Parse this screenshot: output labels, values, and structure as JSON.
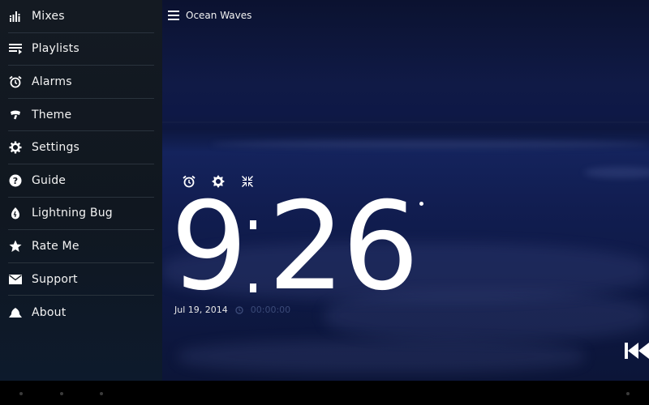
{
  "topbar": {
    "title": "Ocean Waves",
    "menu_icon": "hamburger-icon"
  },
  "drawer": {
    "items": [
      {
        "label": "Mixes",
        "icon": "equalizer-icon"
      },
      {
        "label": "Playlists",
        "icon": "playlist-icon"
      },
      {
        "label": "Alarms",
        "icon": "alarm-icon"
      },
      {
        "label": "Theme",
        "icon": "paint-brush-icon"
      },
      {
        "label": "Settings",
        "icon": "gear-icon"
      },
      {
        "label": "Guide",
        "icon": "help-icon"
      },
      {
        "label": "Lightning Bug",
        "icon": "lightning-bug-icon"
      },
      {
        "label": "Rate Me",
        "icon": "star-icon"
      },
      {
        "label": "Support",
        "icon": "envelope-icon"
      },
      {
        "label": "About",
        "icon": "cloud-icon"
      }
    ]
  },
  "clock": {
    "icons": [
      "alarm-icon",
      "brightness-icon",
      "collapse-icon"
    ],
    "hour": "9",
    "minutes": "26",
    "date": "Jul 19, 2014",
    "timer": "00:00:00"
  },
  "controls": {
    "rewind_icon": "rewind-icon"
  },
  "colors": {
    "drawer_bg": "#121820",
    "divider": "#2a333d",
    "sky": "#0b1230",
    "sea": "#14235c",
    "text": "#ffffff"
  }
}
